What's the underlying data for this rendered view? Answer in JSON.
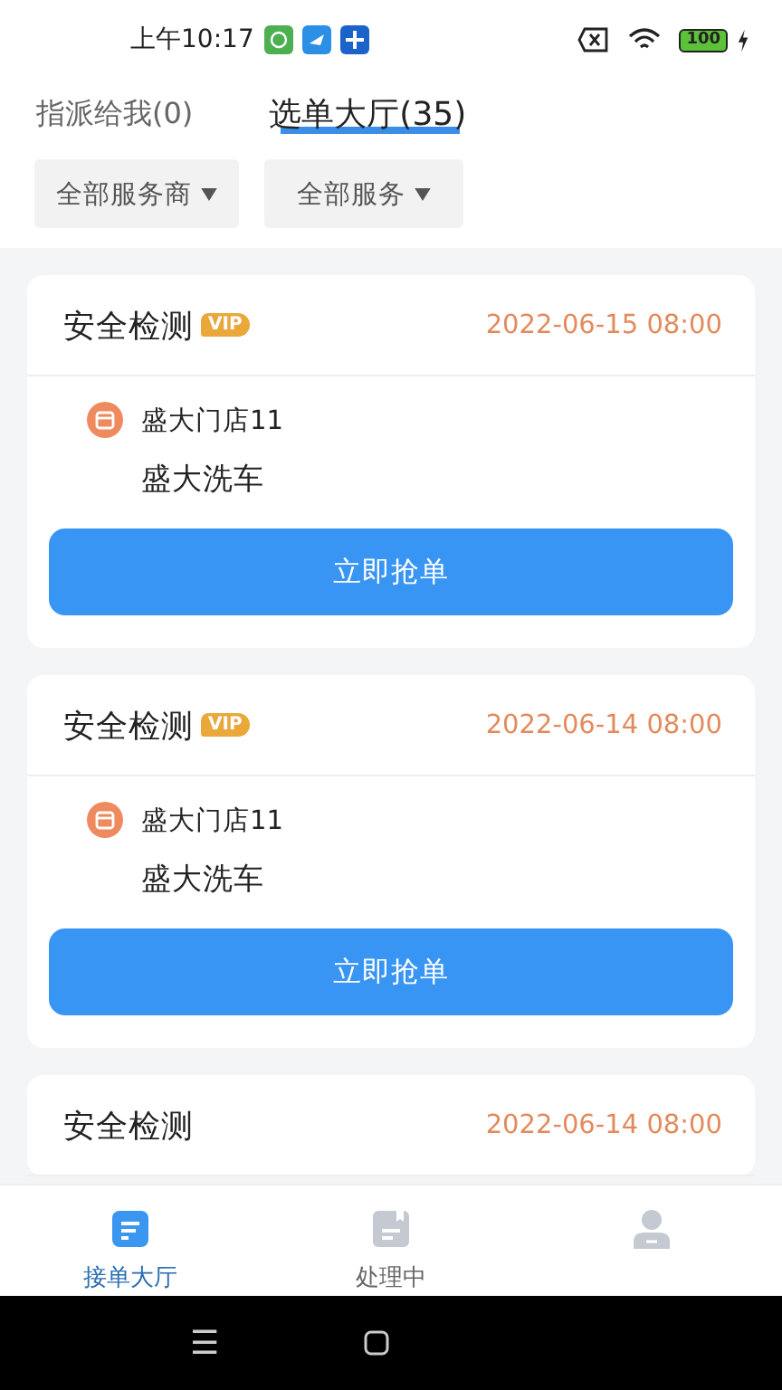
{
  "status_bar": {
    "time": "上午10:17",
    "battery": "100"
  },
  "tabs": [
    {
      "label": "指派给我(0)",
      "selected": false
    },
    {
      "label": "选单大厅(35)",
      "selected": true
    }
  ],
  "filters": [
    {
      "label": "全部服务商"
    },
    {
      "label": "全部服务"
    }
  ],
  "orders": [
    {
      "title": "安全检测",
      "vip": true,
      "badge": "VIP",
      "time": "2022-06-15 08:00",
      "store": "盛大门店11",
      "service": "盛大洗车",
      "action": "立即抢单"
    },
    {
      "title": "安全检测",
      "vip": true,
      "badge": "VIP",
      "time": "2022-06-14 08:00",
      "store": "盛大门店11",
      "service": "盛大洗车",
      "action": "立即抢单"
    },
    {
      "title": "安全检测",
      "vip": false,
      "time": "2022-06-14 08:00"
    }
  ],
  "bottom_nav": [
    {
      "kind": "hall",
      "label": "接单大厅",
      "selected": true
    },
    {
      "kind": "processing",
      "label": "处理中",
      "selected": false
    },
    {
      "kind": "profile",
      "selected": false
    }
  ],
  "system_nav": {
    "menu": "☰"
  }
}
